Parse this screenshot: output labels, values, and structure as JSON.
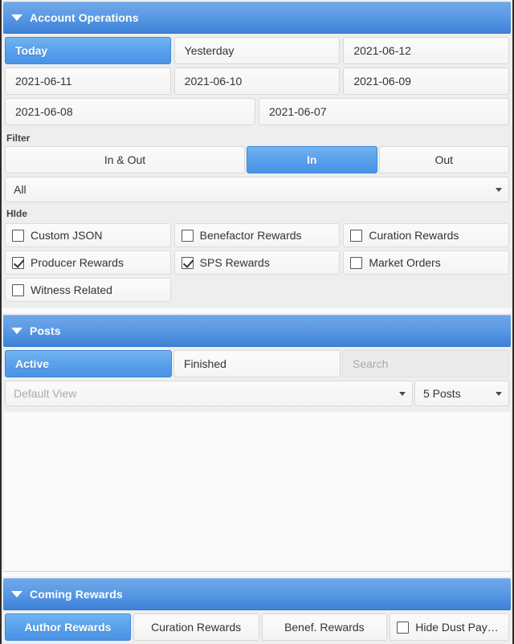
{
  "theme": {
    "accent": "#4a93e6",
    "header_blue_top": "#6fa8e8",
    "header_blue_bottom": "#3d82d9",
    "panel_bg": "#eeeeee",
    "button_bg": "#f7f7f7",
    "text": "#333333",
    "muted_text": "#a9a9a9"
  },
  "account_operations": {
    "title": "Account Operations",
    "caret_icon": "caret-down-icon",
    "dates": [
      [
        {
          "label": "Today",
          "active": true
        },
        {
          "label": "Yesterday",
          "active": false
        },
        {
          "label": "2021-06-12",
          "active": false
        }
      ],
      [
        {
          "label": "2021-06-11",
          "active": false
        },
        {
          "label": "2021-06-10",
          "active": false
        },
        {
          "label": "2021-06-09",
          "active": false
        }
      ],
      [
        {
          "label": "2021-06-08",
          "active": false
        },
        {
          "label": "2021-06-07",
          "active": false
        }
      ]
    ],
    "filter": {
      "label": "Filter",
      "options": [
        {
          "label": "In & Out",
          "active": false
        },
        {
          "label": "In",
          "active": true
        },
        {
          "label": "Out",
          "active": false
        }
      ],
      "type_select": {
        "value": "All",
        "arrow_icon": "caret-down-icon"
      }
    },
    "hide": {
      "label": "HIde",
      "items": [
        [
          {
            "label": "Custom JSON",
            "checked": false
          },
          {
            "label": "Benefactor Rewards",
            "checked": false
          },
          {
            "label": "Curation Rewards",
            "checked": false
          }
        ],
        [
          {
            "label": "Producer Rewards",
            "checked": true
          },
          {
            "label": "SPS Rewards",
            "checked": true
          },
          {
            "label": "Market Orders",
            "checked": false
          }
        ],
        [
          {
            "label": "Witness Related",
            "checked": false
          }
        ]
      ]
    }
  },
  "posts": {
    "title": "Posts",
    "caret_icon": "caret-down-icon",
    "tabs": [
      {
        "label": "Active",
        "active": true
      },
      {
        "label": "Finished",
        "active": false
      }
    ],
    "search": {
      "value": "",
      "placeholder": "Search"
    },
    "view_select": {
      "value": "Default View",
      "arrow_icon": "caret-down-icon"
    },
    "count_select": {
      "value": "5 Posts",
      "arrow_icon": "caret-down-icon"
    }
  },
  "coming_rewards": {
    "title": "Coming Rewards",
    "caret_icon": "caret-down-icon",
    "tabs": [
      {
        "label": "Author Rewards",
        "active": true
      },
      {
        "label": "Curation Rewards",
        "active": false
      },
      {
        "label": "Benef. Rewards",
        "active": false
      }
    ],
    "hide_dust": {
      "label": "Hide Dust Payouts",
      "checked": false
    }
  }
}
